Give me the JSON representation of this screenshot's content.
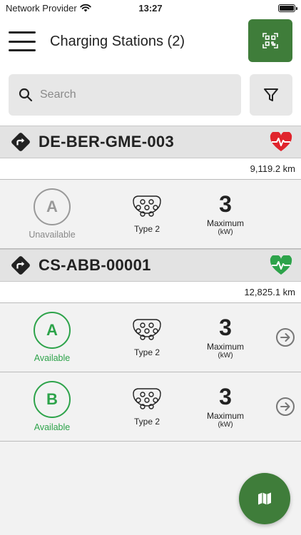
{
  "status_bar": {
    "carrier": "Network Provider",
    "time": "13:27"
  },
  "header": {
    "title": "Charging Stations",
    "count": "(2)"
  },
  "search": {
    "placeholder": "Search"
  },
  "stations": [
    {
      "name": "DE-BER-GME-003",
      "health": "bad",
      "distance": "9,119.2 km",
      "connectors": [
        {
          "id": "A",
          "status": "Unavailable",
          "type": "Type 2",
          "power": "3",
          "power_label": "Maximum",
          "power_unit": "(kW)"
        }
      ]
    },
    {
      "name": "CS-ABB-00001",
      "health": "good",
      "distance": "12,825.1 km",
      "connectors": [
        {
          "id": "A",
          "status": "Available",
          "type": "Type 2",
          "power": "3",
          "power_label": "Maximum",
          "power_unit": "(kW)"
        },
        {
          "id": "B",
          "status": "Available",
          "type": "Type 2",
          "power": "3",
          "power_label": "Maximum",
          "power_unit": "(kW)"
        }
      ]
    }
  ],
  "colors": {
    "accent": "#3f7d3a",
    "available": "#2da34a",
    "unavailable": "#999999",
    "heart_bad": "#e0242c",
    "heart_good": "#2da34a"
  }
}
